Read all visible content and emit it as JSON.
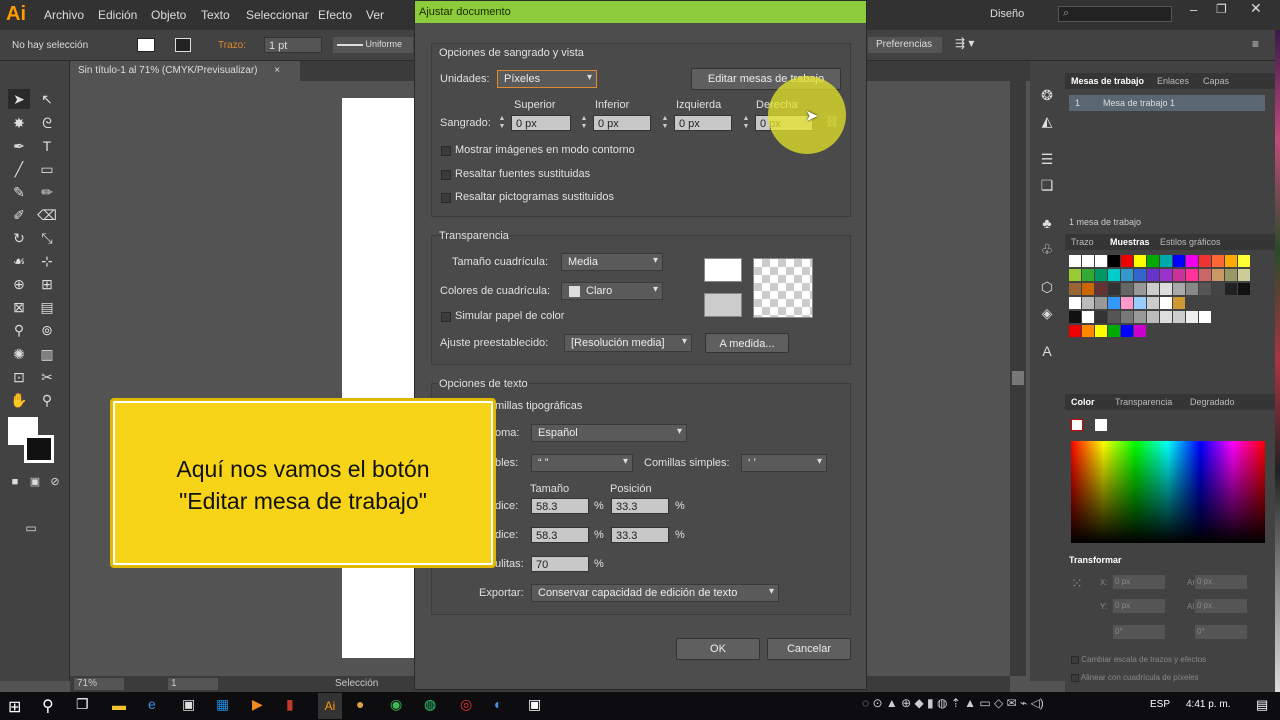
{
  "app": {
    "logo": "Ai",
    "menus": [
      "Archivo",
      "Edición",
      "Objeto",
      "Texto",
      "Seleccionar",
      "Efecto",
      "Ver"
    ],
    "workspace": "Diseño",
    "search_placeholder": ""
  },
  "control_bar": {
    "selection": "No hay selección",
    "trazo_label": "Trazo:",
    "stroke_weight": "1 pt",
    "stroke_profile": "Uniforme",
    "preferences": "Preferencias"
  },
  "document_tab": "Sin título-1 al 71% (CMYK/Previsualizar)",
  "status": {
    "zoom": "71%",
    "artboard_num": "1",
    "tool": "Selección"
  },
  "dialog": {
    "title": "Ajustar documento",
    "section1": {
      "title": "Opciones de sangrado y vista",
      "units_label": "Unidades:",
      "units_value": "Píxeles",
      "edit_artboards_button": "Editar mesas de trabajo",
      "bleed_label": "Sangrado:",
      "bleed_headers": [
        "Superior",
        "Inferior",
        "Izquierda",
        "Derecha"
      ],
      "bleed_values": [
        "0 px",
        "0 px",
        "0 px",
        "0 px"
      ],
      "checkboxes": [
        "Mostrar imágenes en modo contorno",
        "Resaltar fuentes sustituidas",
        "Resaltar pictogramas sustituidos"
      ]
    },
    "section2": {
      "title": "Transparencia",
      "grid_size_label": "Tamaño cuadrícula:",
      "grid_size_value": "Media",
      "grid_colors_label": "Colores de cuadrícula:",
      "grid_colors_value": "Claro",
      "simulate_paper": "Simular papel de color",
      "preset_label": "Ajuste preestablecido:",
      "preset_value": "[Resolución media]",
      "custom_button": "A medida..."
    },
    "section3": {
      "title": "Opciones de texto",
      "typographic_quotes": "millas tipográficas",
      "language_label": "oma:",
      "language_value": "Español",
      "double_quotes_label": "bles:",
      "double_quotes_value": "“ ”",
      "single_quotes_label": "Comillas simples:",
      "single_quotes_value": "‘ ’",
      "size_header": "Tamaño",
      "position_header": "Posición",
      "superscript_label": "dice:",
      "superscript_size": "58.3",
      "superscript_pos": "33.3",
      "subscript_label": "dice:",
      "subscript_size": "58.3",
      "subscript_pos": "33.3",
      "smallcaps_label": "ulitas:",
      "smallcaps_value": "70",
      "percent": "%",
      "export_label": "Exportar:",
      "export_value": "Conservar capacidad de edición de texto"
    },
    "ok": "OK",
    "cancel": "Cancelar"
  },
  "callout": {
    "line1": "Aquí nos vamos el botón",
    "line2": "\"Editar mesa de trabajo\""
  },
  "panels": {
    "artboards_tabs": [
      "Mesas de trabajo",
      "Enlaces",
      "Capas"
    ],
    "artboard_row_num": "1",
    "artboard_row_name": "Mesa de trabajo 1",
    "artboards_count": "1 mesa de trabajo",
    "swatch_tabs": [
      "Trazo",
      "Muestras",
      "Estilos gráficos"
    ],
    "color_tabs": [
      "Color",
      "Transparencia",
      "Degradado"
    ],
    "transform_title": "Transformar",
    "transform_fields": {
      "x_label": "X:",
      "x": "0 px",
      "w_label": "An.:",
      "w": "0 px",
      "y_label": "Y:",
      "y": "0 px",
      "h_label": "Al.:",
      "h": "0 px",
      "angle1": "0°",
      "angle2": "0°"
    },
    "transform_checks": [
      "Cambiar escala de trazos y efectos",
      "Alinear con cuadrícula de píxeles"
    ]
  },
  "taskbar": {
    "lang": "ESP",
    "time": "4:41 p. m."
  }
}
